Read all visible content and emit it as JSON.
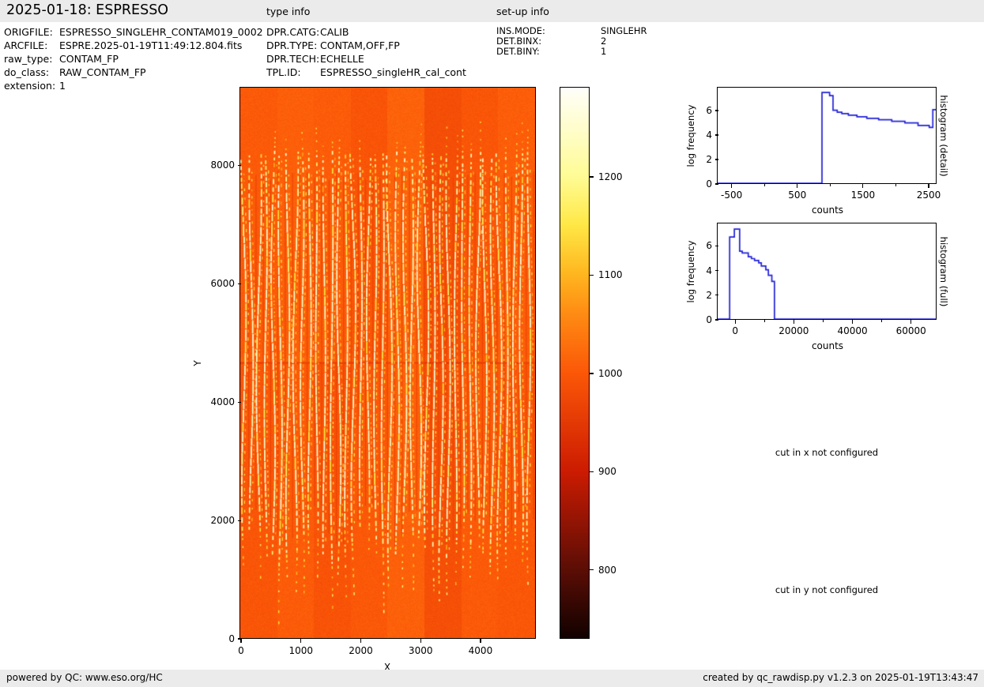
{
  "header": {
    "title": "2025-01-18: ESPRESSO",
    "type_info_label": "type info",
    "setup_info_label": "set-up info"
  },
  "file_info": {
    "rows": [
      {
        "label": "ORIGFILE:",
        "value": "ESPRESSO_SINGLEHR_CONTAM019_0002"
      },
      {
        "label": "ARCFILE:",
        "value": "ESPRE.2025-01-19T11:49:12.804.fits"
      },
      {
        "label": "raw_type:",
        "value": "CONTAM_FP"
      },
      {
        "label": "do_class:",
        "value": "RAW_CONTAM_FP"
      },
      {
        "label": "extension:",
        "value": "1"
      }
    ]
  },
  "type_info": {
    "rows": [
      {
        "label": "DPR.CATG:",
        "value": "CALIB"
      },
      {
        "label": "DPR.TYPE:",
        "value": "CONTAM,OFF,FP"
      },
      {
        "label": "DPR.TECH:",
        "value": "ECHELLE"
      },
      {
        "label": "TPL.ID:",
        "value": "ESPRESSO_singleHR_cal_cont"
      }
    ]
  },
  "setup_info": {
    "rows": [
      {
        "label": "INS.MODE:",
        "value": "SINGLEHR"
      },
      {
        "label": "DET.BINX:",
        "value": "2"
      },
      {
        "label": "DET.BINY:",
        "value": "1"
      }
    ]
  },
  "messages": {
    "cut_x": "cut in x not configured",
    "cut_y": "cut in y not configured"
  },
  "footer": {
    "left": "powered by QC: www.eso.org/HC",
    "right": "created by qc_rawdisp.py v1.2.3 on 2025-01-19T13:43:47"
  },
  "colors": {
    "header_bg": "#ebebeb",
    "footer_bg": "#ebebeb",
    "line_blue": "#2121d6",
    "text": "#000000"
  },
  "chart_data": [
    {
      "type": "heatmap",
      "name": "raw-detector-image",
      "xlabel": "X",
      "ylabel": "Y",
      "xlim": [
        0,
        4925
      ],
      "ylim": [
        0,
        9300
      ],
      "xticks": [
        0,
        1000,
        2000,
        3000,
        4000
      ],
      "yticks": [
        0,
        2000,
        4000,
        6000,
        8000
      ],
      "grid": false,
      "colormap": "hot",
      "colorbar": {
        "vmin": 730,
        "vmax": 1290,
        "ticks": [
          800,
          900,
          1000,
          1100,
          1200
        ],
        "cmap_stops": [
          [
            730,
            18,
            2,
            0
          ],
          [
            800,
            92,
            14,
            6
          ],
          [
            900,
            205,
            28,
            2
          ],
          [
            1000,
            252,
            88,
            8
          ],
          [
            1060,
            255,
            140,
            20
          ],
          [
            1100,
            255,
            182,
            32
          ],
          [
            1150,
            255,
            232,
            70
          ],
          [
            1200,
            255,
            252,
            150
          ],
          [
            1290,
            255,
            255,
            250
          ]
        ]
      },
      "image": {
        "background_value": 1000,
        "band_values_lower": [
          996,
          1004,
          992,
          1000,
          1010,
          986,
          1002,
          998
        ],
        "band_values_upper": [
          1002,
          1008,
          1004,
          994,
          1012,
          984,
          996,
          1006
        ],
        "num_bands": 8,
        "noise": 9,
        "stripes": {
          "count": 40,
          "x0_data": 60,
          "spacing_data": 122,
          "y_top_data": 8280,
          "y_bottom_data": 1080,
          "bright_value": 1265,
          "secondary_value": 1100,
          "dark_value": 966
        },
        "chip_gap": {
          "y_data": 4648,
          "gap_value": 952,
          "halo_value": 1012
        }
      }
    },
    {
      "type": "line",
      "name": "histogram-detail",
      "xlabel": "counts",
      "ylabel": "log frequency",
      "right_label": "histogram (detail)",
      "xlim": [
        -700,
        2620
      ],
      "ylim": [
        0,
        7.8
      ],
      "xticks": [
        -500,
        500,
        1500,
        2500
      ],
      "xticks_minor": [
        0,
        1000,
        2000
      ],
      "yticks": [
        0,
        2,
        4,
        6
      ],
      "x": [
        -700,
        888,
        888,
        1004,
        1004,
        1056,
        1056,
        1120,
        1120,
        1190,
        1190,
        1290,
        1290,
        1420,
        1420,
        1570,
        1570,
        1750,
        1750,
        1950,
        1950,
        2150,
        2150,
        2350,
        2350,
        2520,
        2520,
        2575,
        2575,
        2620
      ],
      "y": [
        0,
        0,
        7.4,
        7.4,
        7.15,
        7.15,
        5.95,
        5.95,
        5.8,
        5.8,
        5.68,
        5.68,
        5.55,
        5.55,
        5.42,
        5.42,
        5.3,
        5.3,
        5.18,
        5.18,
        5.05,
        5.05,
        4.92,
        4.92,
        4.72,
        4.72,
        4.55,
        4.55,
        6.0,
        6.0
      ]
    },
    {
      "type": "line",
      "name": "histogram-full",
      "xlabel": "counts",
      "ylabel": "log frequency",
      "right_label": "histogram (full)",
      "xlim": [
        -5700,
        68700
      ],
      "ylim": [
        0,
        7.75
      ],
      "xticks": [
        0,
        20000,
        40000,
        60000
      ],
      "xticks_minor": [
        10000,
        30000,
        50000
      ],
      "yticks": [
        0,
        2,
        4,
        6
      ],
      "x": [
        -5700,
        -1600,
        -1600,
        0,
        0,
        1800,
        1800,
        2680,
        2680,
        4740,
        4740,
        5820,
        5820,
        6890,
        6890,
        8300,
        8300,
        9190,
        9190,
        10720,
        10720,
        11600,
        11600,
        12780,
        12780,
        13670,
        13670,
        68700
      ],
      "y": [
        0,
        0,
        6.65,
        6.65,
        7.3,
        7.3,
        5.5,
        5.5,
        5.35,
        5.35,
        5.05,
        5.05,
        4.9,
        4.9,
        4.75,
        4.75,
        4.55,
        4.55,
        4.3,
        4.3,
        4.0,
        4.0,
        3.55,
        3.55,
        3.05,
        3.05,
        0,
        0
      ]
    }
  ]
}
